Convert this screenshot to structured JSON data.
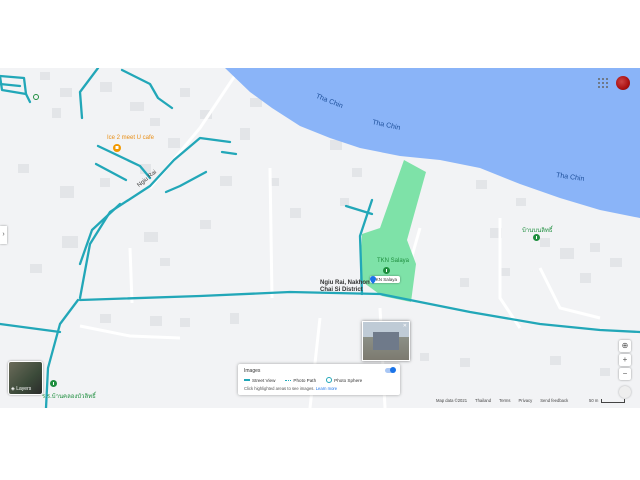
{
  "map": {
    "colors": {
      "land": "#f2f3f5",
      "water": "#8ab4f8",
      "park": "#7ee2a8",
      "road": "#22a7b8",
      "building": "#e3e5e8"
    },
    "river_label_1": "Tha Chin",
    "river_label_2": "Tha Chin",
    "river_label_3": "Tha Chin",
    "road_label_diag": "Ngiu Rai",
    "location_label_line1": "Ngiu Rai, Nakhon",
    "location_label_line2": "Chai Si District",
    "poi_cafe": "Ice 2 meet U cafe",
    "park_top_label": "TKN Salaya",
    "park_pin_label": "TKN Salaya",
    "place_right": "บ้านบนลิทธิ์",
    "place_bottom_left": "ร.ร.บ้านคลองบัวลิทธิ์"
  },
  "layers": {
    "label": "Layers",
    "icon": "layers-icon"
  },
  "images_panel": {
    "title": "Images",
    "legend": [
      "Street View",
      "Photo Path",
      "Photo Sphere"
    ],
    "hint": "Click highlighted areas to see images.",
    "hint_link": "Learn more"
  },
  "controls": {
    "zoom_in": "+",
    "zoom_out": "−",
    "locate_icon": "my-location-icon"
  },
  "footer": {
    "map_data": "Map data ©2021",
    "country": "Thailand",
    "terms": "Terms",
    "privacy": "Privacy",
    "feedback": "Send feedback",
    "scale": "50 m"
  }
}
